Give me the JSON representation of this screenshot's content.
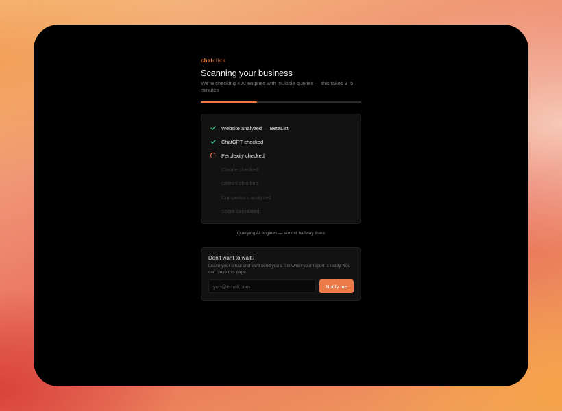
{
  "brand": {
    "part1": "chat",
    "part2": "click"
  },
  "header": {
    "title": "Scanning your business",
    "subtitle": "We're checking 4 AI engines with multiple queries — this takes 3–5 minutes"
  },
  "progress": {
    "fraction": 0.35,
    "color": "#f07a45"
  },
  "steps": [
    {
      "label": "Website analyzed — BetaList",
      "state": "done",
      "icon": "check-icon"
    },
    {
      "label": "ChatGPT checked",
      "state": "done",
      "icon": "check-icon"
    },
    {
      "label": "Perplexity checked",
      "state": "active",
      "icon": "spinner-icon"
    },
    {
      "label": "Claude checked",
      "state": "pending",
      "icon": ""
    },
    {
      "label": "Gemini checked",
      "state": "pending",
      "icon": ""
    },
    {
      "label": "Competitors analyzed",
      "state": "pending",
      "icon": ""
    },
    {
      "label": "Score calculated",
      "state": "pending",
      "icon": ""
    }
  ],
  "status_text": "Querying AI engines — almost halfway there",
  "notify": {
    "title": "Don't want to wait?",
    "description": "Leave your email and we'll send you a link when your report is ready. You can close this page.",
    "email_placeholder": "you@email.com",
    "email_value": "",
    "button_label": "Notify me"
  },
  "colors": {
    "accent": "#f07a45",
    "check": "#3fcf8e",
    "window": "#000000"
  }
}
